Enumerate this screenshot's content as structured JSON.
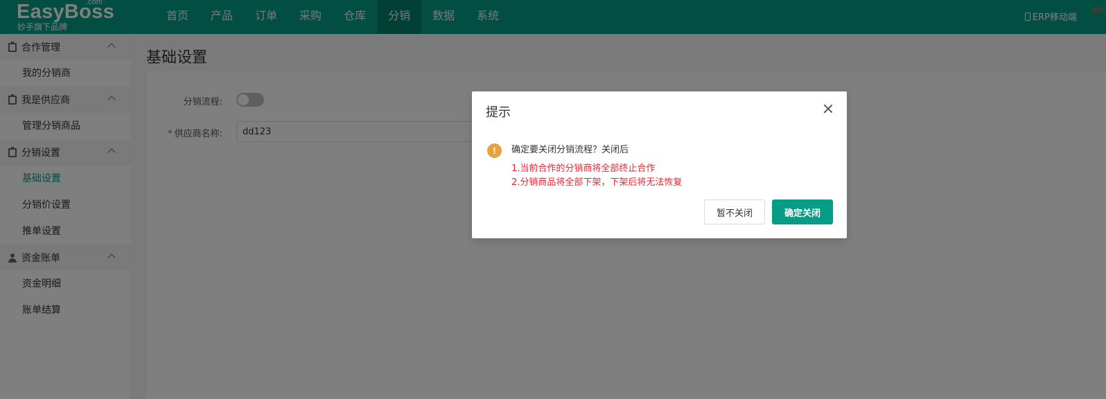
{
  "header": {
    "logo_main": "EasyBoss",
    "logo_com": ".com",
    "logo_sub": "妙手旗下品牌",
    "nav": [
      {
        "label": "首页"
      },
      {
        "label": "产品"
      },
      {
        "label": "订单"
      },
      {
        "label": "采购"
      },
      {
        "label": "仓库"
      },
      {
        "label": "分销",
        "active": true
      },
      {
        "label": "数据"
      },
      {
        "label": "系统"
      }
    ],
    "erp_mobile": "ERP移动端",
    "hot_badge": "HOT"
  },
  "sidebar": {
    "groups": [
      {
        "label": "合作管理",
        "icon": "clipboard-icon",
        "items": [
          {
            "label": "我的分销商"
          }
        ]
      },
      {
        "label": "我是供应商",
        "icon": "clipboard-icon",
        "items": [
          {
            "label": "管理分销商品"
          }
        ]
      },
      {
        "label": "分销设置",
        "icon": "clipboard-icon",
        "items": [
          {
            "label": "基础设置",
            "active": true
          },
          {
            "label": "分销价设置"
          },
          {
            "label": "推单设置"
          }
        ]
      },
      {
        "label": "资金账单",
        "icon": "user-icon",
        "items": [
          {
            "label": "资金明细"
          },
          {
            "label": "账单结算"
          }
        ]
      }
    ]
  },
  "main": {
    "title": "基础设置",
    "form": {
      "flow_label": "分销流程:",
      "flow_enabled": false,
      "supplier_label": "供应商名称:",
      "supplier_value": "dd123"
    }
  },
  "dialog": {
    "title": "提示",
    "message": "确定要关闭分销流程？关闭后",
    "line1": "1.当前合作的分销商将全部终止合作",
    "line2": "2.分销商品将全部下架，下架后将无法恢复",
    "cancel_label": "暂不关闭",
    "confirm_label": "确定关闭"
  },
  "colors": {
    "brand": "#079c86",
    "danger": "#f5222d",
    "warning": "#e6a23c"
  }
}
